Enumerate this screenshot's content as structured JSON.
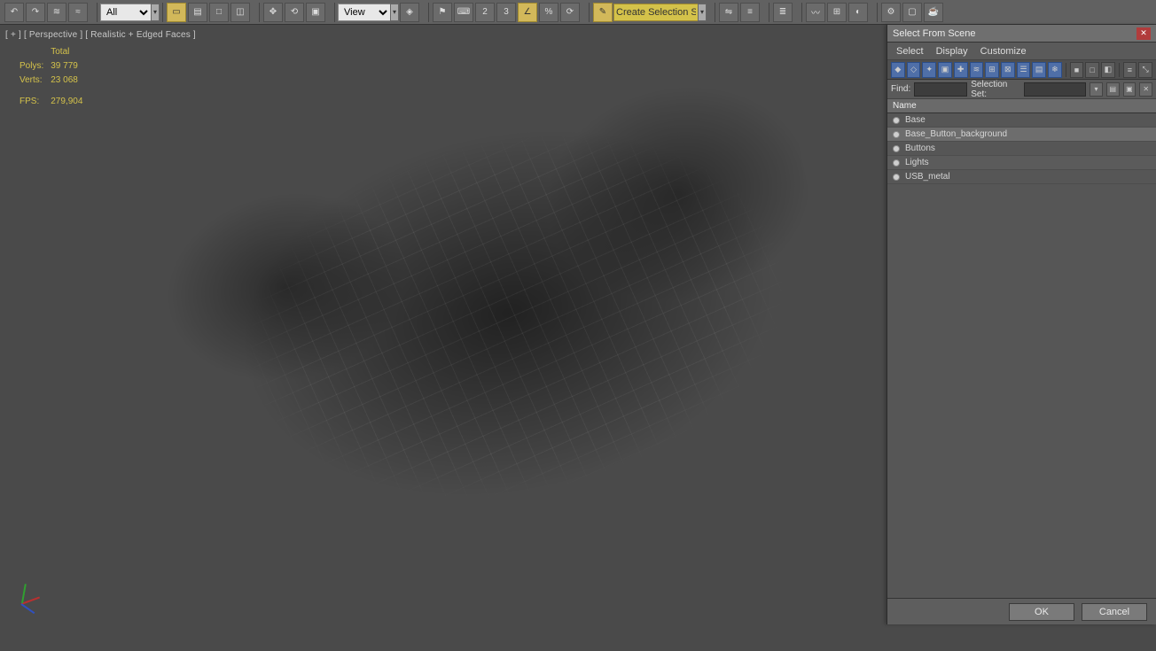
{
  "toolbar": {
    "filter_selector": "All",
    "view_selector": "View",
    "named_set": "Create Selection Se"
  },
  "viewport": {
    "plus": "[ + ]",
    "view": "[ Perspective ]",
    "shading": "[ Realistic + Edged Faces ]",
    "stats": {
      "total_label": "Total",
      "polys_label": "Polys:",
      "polys_value": "39 779",
      "verts_label": "Verts:",
      "verts_value": "23 068",
      "fps_label": "FPS:",
      "fps_value": "279,904"
    }
  },
  "dialog": {
    "title": "Select From Scene",
    "menu": {
      "select": "Select",
      "display": "Display",
      "customize": "Customize"
    },
    "find_label": "Find:",
    "find_value": "",
    "set_label": "Selection Set:",
    "set_value": "",
    "list_header": "Name",
    "items": [
      {
        "name": "Base",
        "selected": false
      },
      {
        "name": "Base_Button_background",
        "selected": true
      },
      {
        "name": "Buttons",
        "selected": false
      },
      {
        "name": "Lights",
        "selected": false
      },
      {
        "name": "USB_metal",
        "selected": false
      }
    ],
    "ok": "OK",
    "cancel": "Cancel"
  }
}
